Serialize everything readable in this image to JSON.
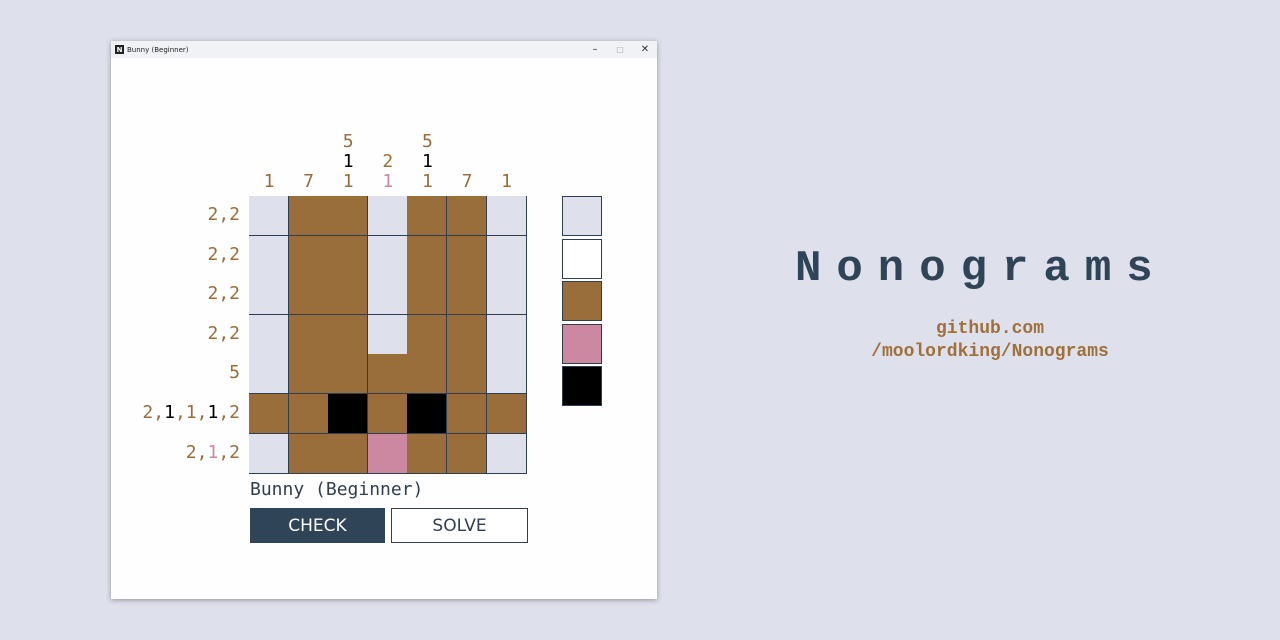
{
  "window": {
    "title": "Bunny (Beginner)",
    "icon_letter": "N",
    "minimize": "–",
    "maximize": "□",
    "close": "✕"
  },
  "colors": {
    "0": "#dee1ec",
    "1": "#ffffff",
    "2": "#9a6e3b",
    "3": "#cc88a0",
    "4": "#000000"
  },
  "palette": [
    {
      "name": "empty",
      "color": "#dee1ec"
    },
    {
      "name": "white",
      "color": "#ffffff"
    },
    {
      "name": "brown",
      "color": "#9a6e3b"
    },
    {
      "name": "pink",
      "color": "#cc88a0"
    },
    {
      "name": "black",
      "color": "#000000"
    }
  ],
  "column_clues": [
    [
      {
        "v": "1",
        "c": "brown"
      }
    ],
    [
      {
        "v": "7",
        "c": "brown"
      }
    ],
    [
      {
        "v": "5",
        "c": "brown"
      },
      {
        "v": "1",
        "c": "black"
      },
      {
        "v": "1",
        "c": "brown"
      }
    ],
    [
      {
        "v": "2",
        "c": "brown"
      },
      {
        "v": "1",
        "c": "pink"
      }
    ],
    [
      {
        "v": "5",
        "c": "brown"
      },
      {
        "v": "1",
        "c": "black"
      },
      {
        "v": "1",
        "c": "brown"
      }
    ],
    [
      {
        "v": "7",
        "c": "brown"
      }
    ],
    [
      {
        "v": "1",
        "c": "brown"
      }
    ]
  ],
  "row_clues": [
    [
      {
        "v": "2",
        "c": "brown"
      },
      {
        "v": "2",
        "c": "brown"
      }
    ],
    [
      {
        "v": "2",
        "c": "brown"
      },
      {
        "v": "2",
        "c": "brown"
      }
    ],
    [
      {
        "v": "2",
        "c": "brown"
      },
      {
        "v": "2",
        "c": "brown"
      }
    ],
    [
      {
        "v": "2",
        "c": "brown"
      },
      {
        "v": "2",
        "c": "brown"
      }
    ],
    [
      {
        "v": "5",
        "c": "brown"
      }
    ],
    [
      {
        "v": "2",
        "c": "brown"
      },
      {
        "v": "1",
        "c": "black"
      },
      {
        "v": "1",
        "c": "brown"
      },
      {
        "v": "1",
        "c": "black"
      },
      {
        "v": "2",
        "c": "brown"
      }
    ],
    [
      {
        "v": "2",
        "c": "brown"
      },
      {
        "v": "1",
        "c": "pink"
      },
      {
        "v": "2",
        "c": "brown"
      }
    ]
  ],
  "grid": [
    [
      0,
      2,
      2,
      0,
      2,
      2,
      0
    ],
    [
      0,
      2,
      2,
      0,
      2,
      2,
      0
    ],
    [
      0,
      2,
      2,
      0,
      2,
      2,
      0
    ],
    [
      0,
      2,
      2,
      0,
      2,
      2,
      0
    ],
    [
      0,
      2,
      2,
      2,
      2,
      2,
      0
    ],
    [
      2,
      2,
      4,
      2,
      4,
      2,
      2
    ],
    [
      0,
      2,
      2,
      3,
      2,
      2,
      0
    ]
  ],
  "puzzle": {
    "title": "Bunny (Beginner)",
    "check_label": "CHECK",
    "solve_label": "SOLVE"
  },
  "banner": {
    "title": "Nonograms",
    "link_line1": "github.com",
    "link_line2": "/moolordking/Nonograms"
  }
}
